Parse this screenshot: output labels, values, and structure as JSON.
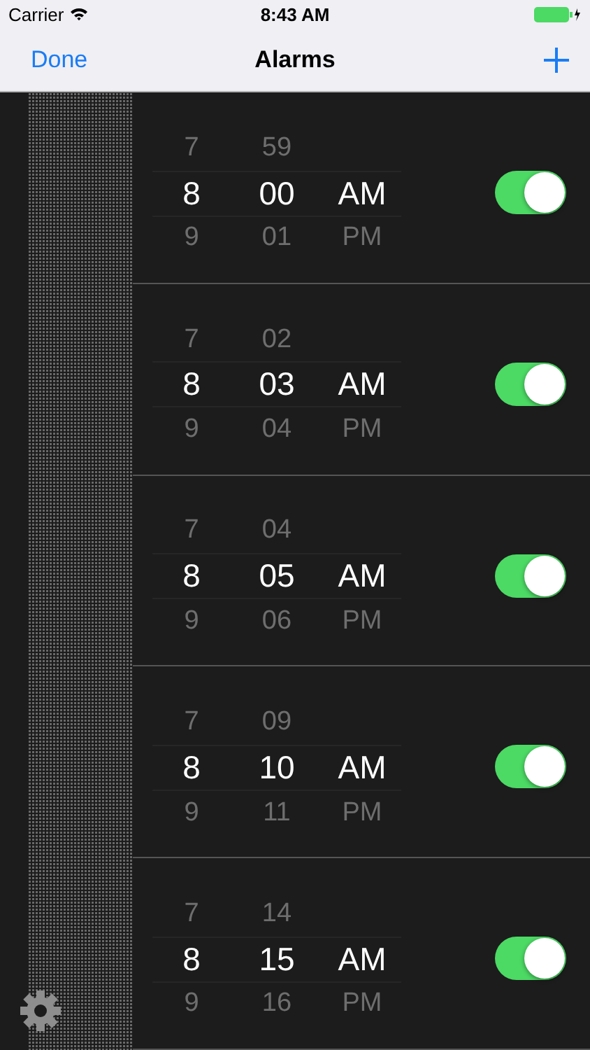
{
  "status_bar": {
    "carrier": "Carrier",
    "time": "8:43 AM"
  },
  "nav_bar": {
    "left_button": "Done",
    "title": "Alarms"
  },
  "alarms": [
    {
      "hours": [
        "7",
        "8",
        "9"
      ],
      "minutes": [
        "59",
        "00",
        "01"
      ],
      "periods": [
        "AM",
        "PM"
      ],
      "on": true
    },
    {
      "hours": [
        "7",
        "8",
        "9"
      ],
      "minutes": [
        "02",
        "03",
        "04"
      ],
      "periods": [
        "AM",
        "PM"
      ],
      "on": true
    },
    {
      "hours": [
        "7",
        "8",
        "9"
      ],
      "minutes": [
        "04",
        "05",
        "06"
      ],
      "periods": [
        "AM",
        "PM"
      ],
      "on": true
    },
    {
      "hours": [
        "7",
        "8",
        "9"
      ],
      "minutes": [
        "09",
        "10",
        "11"
      ],
      "periods": [
        "AM",
        "PM"
      ],
      "on": true
    },
    {
      "hours": [
        "7",
        "8",
        "9"
      ],
      "minutes": [
        "14",
        "15",
        "16"
      ],
      "periods": [
        "AM",
        "PM"
      ],
      "on": true
    }
  ]
}
